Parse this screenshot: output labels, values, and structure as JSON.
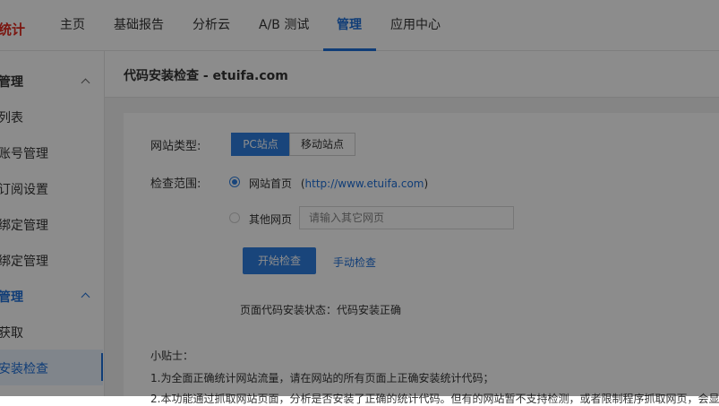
{
  "logo": {
    "text": "统计"
  },
  "nav": [
    {
      "label": "主页"
    },
    {
      "label": "基础报告"
    },
    {
      "label": "分析云"
    },
    {
      "label": "A/B 测试"
    },
    {
      "label": "管理"
    },
    {
      "label": "应用中心"
    }
  ],
  "sidebar": {
    "items": [
      {
        "label": "管理"
      },
      {
        "label": "列表"
      },
      {
        "label": "账号管理"
      },
      {
        "label": "订阅设置"
      },
      {
        "label": "绑定管理"
      },
      {
        "label": "绑定管理"
      },
      {
        "label": "管理"
      },
      {
        "label": "获取"
      },
      {
        "label": "安装检查"
      }
    ]
  },
  "page": {
    "title": "代码安装检查 - etuifa.com"
  },
  "form": {
    "site_type_label": "网站类型:",
    "site_type_options": [
      "PC站点",
      "移动站点"
    ],
    "site_type_selected": "PC站点",
    "scope_label": "检查范围:",
    "option_home": "网站首页",
    "home_url_prefix": "(",
    "home_url": "http://www.etuifa.com",
    "home_url_suffix": ")",
    "option_other": "其他网页",
    "other_placeholder": "请输入其它网页",
    "start_button": "开始检查",
    "manual_link": "手动检查",
    "status_line": "页面代码安装状态：代码安装正确"
  },
  "tips": {
    "title": "小贴士：",
    "line1": "1.为全面正确统计网站流量，请在网站的所有页面上正确安装统计代码；",
    "line2": "2.本功能通过抓取网站页面，分析是否安装了正确的统计代码。但有的网站暂不支持检测，或者限制程序抓取网页，会显"
  },
  "colors": {
    "accent": "#1e6fd9",
    "brand": "#e0281e",
    "overlay": "rgba(0,0,0,0.45)"
  }
}
